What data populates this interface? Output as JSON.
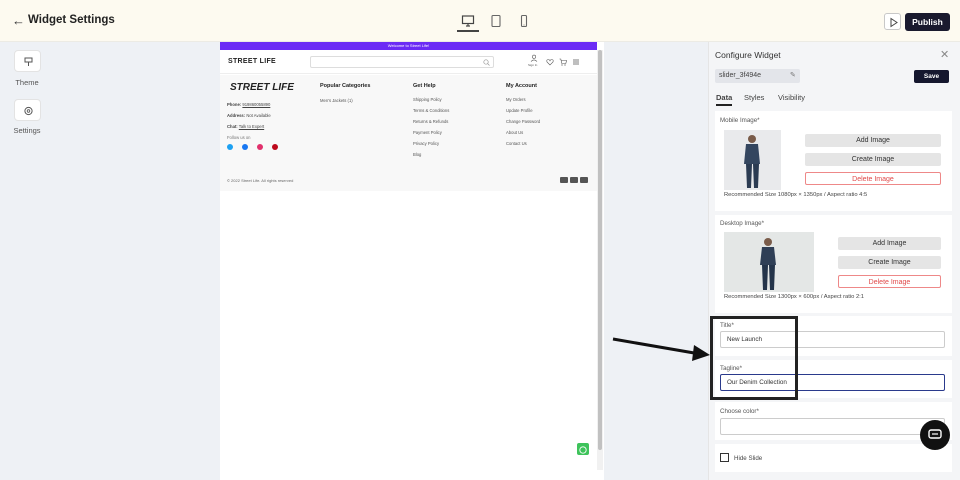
{
  "header": {
    "title": "Widget Settings",
    "publish_label": "Publish"
  },
  "left_rail": {
    "items": [
      {
        "label": "Theme",
        "icon": "paint-brush-icon"
      },
      {
        "label": "Settings",
        "icon": "gear-icon"
      }
    ]
  },
  "preview": {
    "banner": "Welcome to Street Life!",
    "logo": "STREET LIFE",
    "header_signin": "Sign In",
    "footer": {
      "logo": "STREET LIFE",
      "phone_label": "Phone:",
      "phone": "919860055890",
      "address_label": "Address:",
      "address": "Not Available",
      "chat_label": "Chat:",
      "chat": "Talk to Expert",
      "follow": "Follow us on",
      "col1_title": "Popular Categories",
      "col1_links": [
        "Men's Jackets (1)"
      ],
      "col2_title": "Get Help",
      "col2_links": [
        "Shipping Policy",
        "Terms & Conditions",
        "Returns & Refunds",
        "Payment Policy",
        "Privacy Policy",
        "Blog"
      ],
      "col3_title": "My Account",
      "col3_links": [
        "My Orders",
        "Update Profile",
        "Change Password",
        "About Us",
        "Contact Us"
      ],
      "copyright": "© 2022 Street Life. All rights reserved"
    }
  },
  "panel": {
    "title": "Configure Widget",
    "slug": "slider_3f494e",
    "save_label": "Save",
    "tabs": [
      "Data",
      "Styles",
      "Visibility"
    ],
    "mobile_image": {
      "label": "Mobile Image*",
      "add": "Add Image",
      "create": "Create Image",
      "delete": "Delete Image",
      "rec": "Recommended Size 1080px × 1350px / Aspect ratio 4:5"
    },
    "desktop_image": {
      "label": "Desktop Image*",
      "add": "Add Image",
      "create": "Create Image",
      "delete": "Delete Image",
      "rec": "Recommended Size 1300px × 600px / Aspect ratio 2:1"
    },
    "title_field": {
      "label": "Title*",
      "value": "New Launch"
    },
    "tagline_field": {
      "label": "Tagline*",
      "value": "Our Denim Collection"
    },
    "color_field": {
      "label": "Choose color*"
    },
    "hide_slide_label": "Hide Slide"
  },
  "colors": {
    "accent": "#6b2bf5",
    "dark": "#15172e",
    "danger": "#e04a4a",
    "whatsapp": "#3ec35b"
  }
}
